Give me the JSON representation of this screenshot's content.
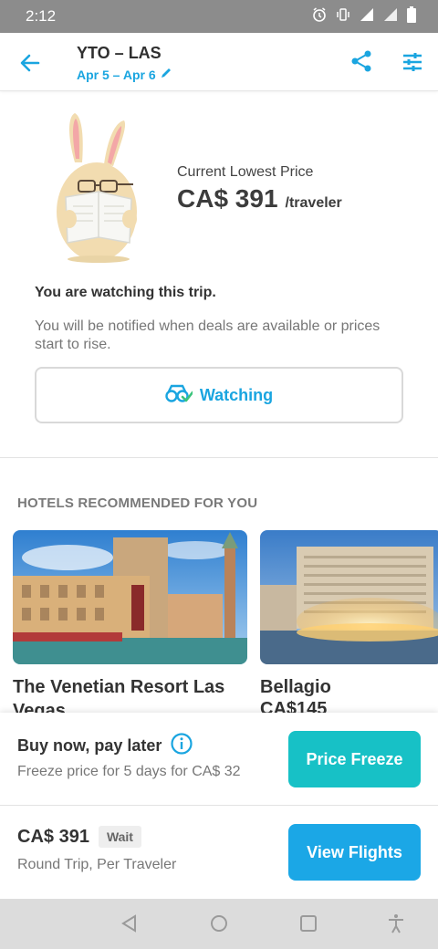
{
  "status_bar": {
    "time": "2:12",
    "icons": [
      "alarm-icon",
      "vibrate-icon",
      "signal-icon",
      "signal-4g-icon",
      "battery-icon"
    ]
  },
  "header": {
    "route": "YTO – LAS",
    "dates": "Apr 5 – Apr 6",
    "icons": [
      "back-arrow-icon",
      "pencil-icon",
      "share-icon",
      "filter-sliders-icon"
    ]
  },
  "price_watch": {
    "label": "Current Lowest Price",
    "price": "CA$ 391",
    "unit": "/traveler",
    "title": "You are watching this trip.",
    "description": "You will be notified when deals are available or prices start to rise.",
    "button_label": "Watching"
  },
  "hotels": {
    "section_title": "HOTELS RECOMMENDED FOR YOU",
    "items": [
      {
        "name": "The Venetian Resort Las Vegas",
        "price": ""
      },
      {
        "name": "Bellagio",
        "price": "CA$145"
      }
    ]
  },
  "bottom_sheet": {
    "bnpl_title": "Buy now, pay later",
    "bnpl_subtitle": "Freeze price for 5 days for CA$ 32",
    "freeze_button": "Price Freeze",
    "total_price": "CA$ 391",
    "badge": "Wait",
    "trip_type": "Round Trip, Per Traveler",
    "flights_button": "View Flights"
  },
  "nav_bar": {
    "icons": [
      "back-triangle-icon",
      "home-circle-icon",
      "recents-square-icon",
      "accessibility-icon"
    ]
  },
  "colors": {
    "accent_blue": "#1aa5e0",
    "freeze_teal": "#17c1c6",
    "flights_blue": "#1ba7e6",
    "watch_check_green": "#3cc47c"
  }
}
